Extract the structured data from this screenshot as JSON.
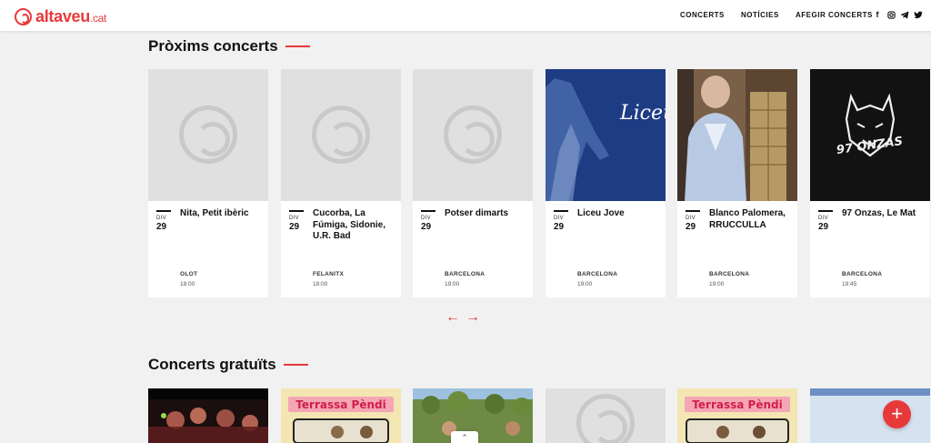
{
  "brand": {
    "name": "altaveu",
    "tld": ".cat",
    "color": "#e8393a"
  },
  "nav": {
    "items": [
      "CONCERTS",
      "NOTÍCIES",
      "AFEGIR CONCERTS"
    ]
  },
  "social": [
    "facebook-icon",
    "instagram-icon",
    "telegram-icon",
    "twitter-icon"
  ],
  "sections": {
    "upcoming": {
      "title": "Pròxims concerts",
      "cards": [
        {
          "dow": "DIV",
          "day": "29",
          "title": "Nita, Petit ibèric",
          "city": "OLOT",
          "time": "18:00",
          "image": "placeholder"
        },
        {
          "dow": "DIV",
          "day": "29",
          "title": "Cucorba, La Fúmiga, Sidonie, U.R. Bad",
          "city": "FELANITX",
          "time": "18:00",
          "image": "placeholder"
        },
        {
          "dow": "DIV",
          "day": "29",
          "title": "Potser dimarts",
          "city": "BARCELONA",
          "time": "19:00",
          "image": "placeholder"
        },
        {
          "dow": "DIV",
          "day": "29",
          "title": "Liceu Jove",
          "city": "BARCELONA",
          "time": "19:00",
          "image": "liceu"
        },
        {
          "dow": "DIV",
          "day": "29",
          "title": "Blanco Palomera, RRUCCULLA",
          "city": "BARCELONA",
          "time": "19:00",
          "image": "photo"
        },
        {
          "dow": "DIV",
          "day": "29",
          "title": "97 Onzas, Le Mat",
          "city": "BARCELONA",
          "time": "19:45",
          "image": "onzas"
        }
      ]
    },
    "free": {
      "title": "Concerts gratuïts"
    }
  },
  "posters": {
    "liceu_text": "Liceu Jove",
    "onzas_text": "97 ONZAS",
    "terrassa_text": "Terrassa Pèndi"
  },
  "controls": {
    "prev": "←",
    "next": "→",
    "add": "+",
    "scroll_up": "⌃"
  }
}
